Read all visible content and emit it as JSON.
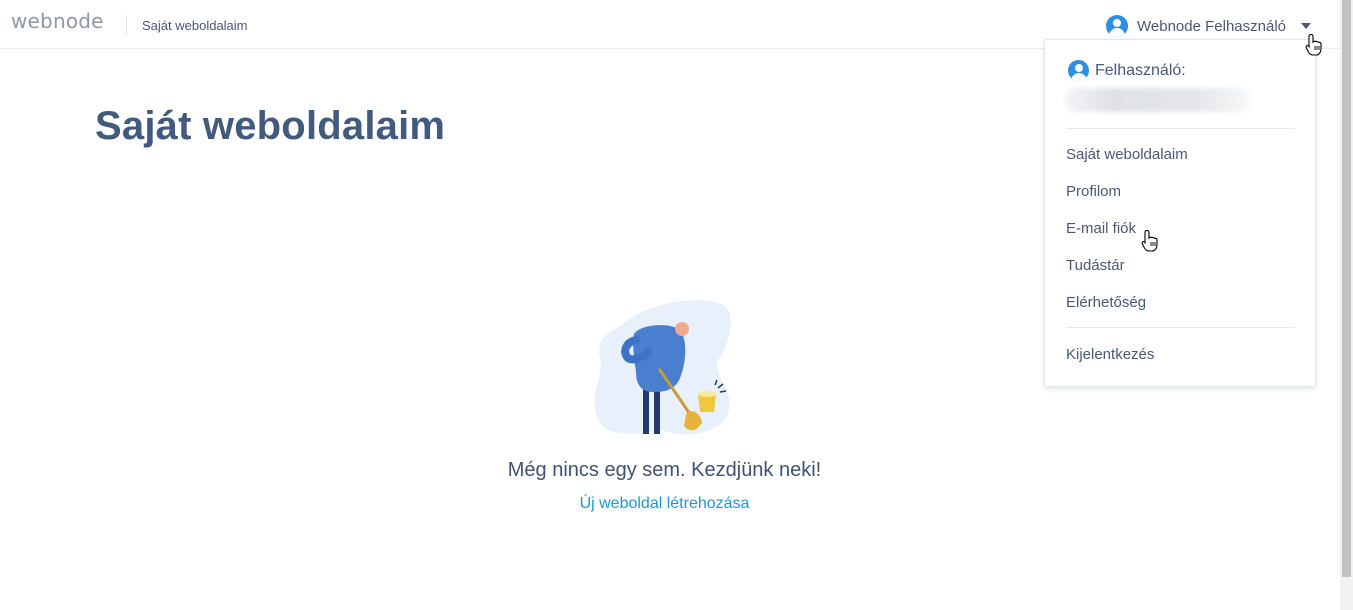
{
  "header": {
    "logo": "webnode",
    "breadcrumb": "Saját weboldalaim",
    "user_name": "Webnode Felhasználó",
    "icons": {
      "avatar": "user-avatar-icon",
      "caret": "caret-down-icon"
    }
  },
  "main": {
    "title": "Saját weboldalaim",
    "empty_message": "Még nincs egy sem. Kezdjünk neki!",
    "create_link": "Új weboldal létrehozása",
    "illustration": "person-sweeping-illustration"
  },
  "dropdown": {
    "user_label": "Felhasználó:",
    "email_blurred": true,
    "items": [
      {
        "label": "Saját weboldalaim"
      },
      {
        "label": "Profilom"
      },
      {
        "label": "E-mail fiók"
      },
      {
        "label": "Tudástár"
      },
      {
        "label": "Elérhetőség"
      }
    ],
    "logout": "Kijelentkezés"
  },
  "colors": {
    "accent": "#1f96d6",
    "avatar": "#2d8fe4",
    "heading": "#435a7f",
    "text": "#4a5874"
  }
}
